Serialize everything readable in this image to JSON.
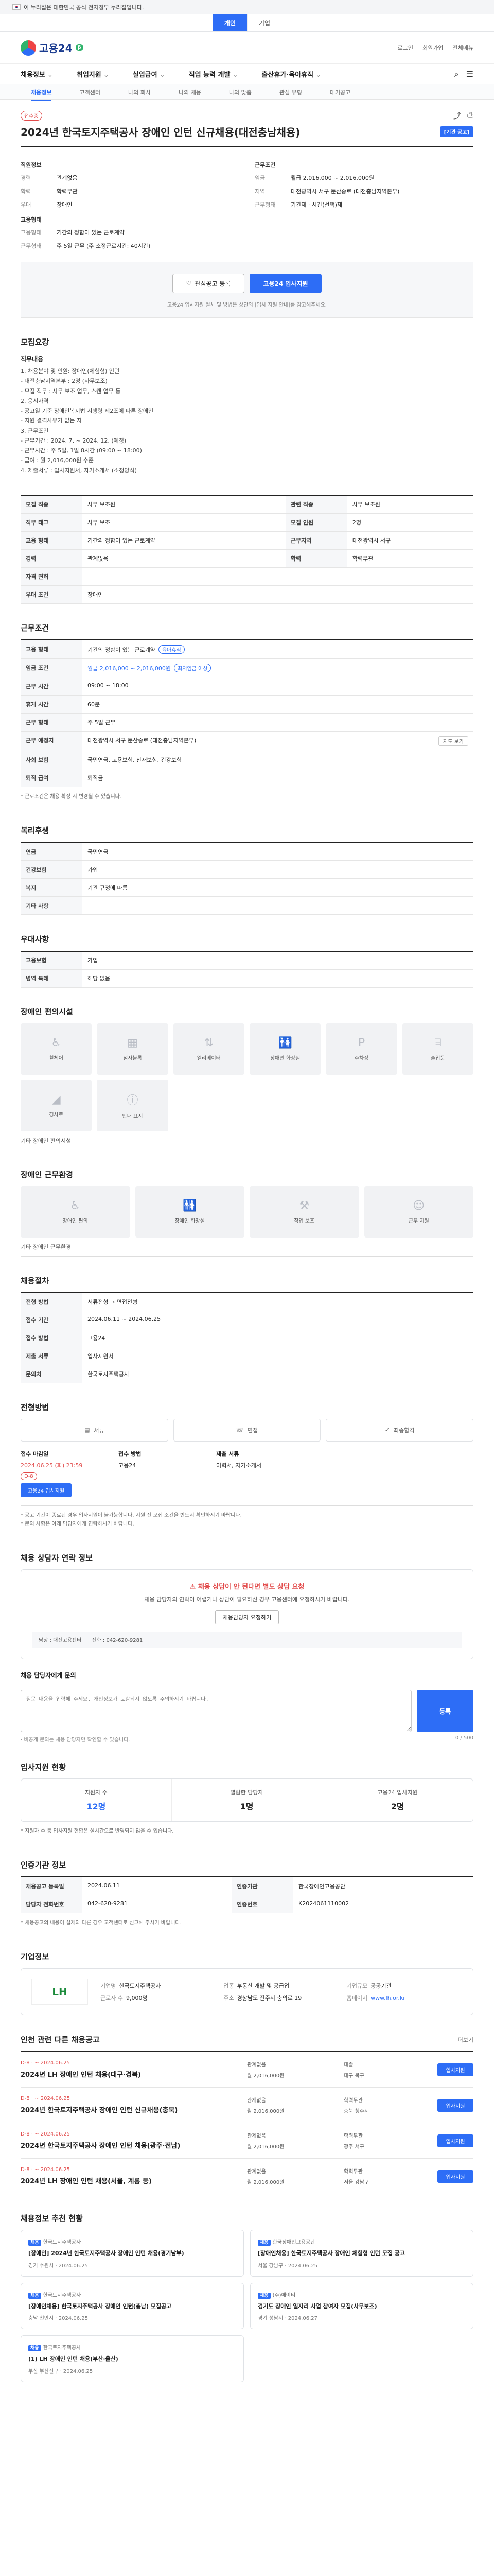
{
  "banner": {
    "text": "이 누리집은 대한민국 공식 전자정부 누리집입니다."
  },
  "top_tabs": [
    "개인",
    "기업"
  ],
  "logo": {
    "text": "고용24",
    "badge": "β"
  },
  "header_links": [
    "로그인",
    "회원가입",
    "전체메뉴"
  ],
  "gnb": [
    "채용정보",
    "취업지원",
    "실업급여",
    "직업 능력 개발",
    "출산휴가·육아휴직"
  ],
  "subnav": [
    "채용정보",
    "고객센터",
    "나의 회사",
    "나의 채용",
    "나의 맞춤",
    "관심 유형",
    "대기공고"
  ],
  "job": {
    "status_badge": "접수중",
    "title": "2024년 한국토지주택공사 장애인 인턴 신규채용(대전충남채용)",
    "apply_btn": "[기관 공고]",
    "summary_head_left": "직원정보",
    "summary_head_right": "근무조건",
    "summary_left": [
      {
        "k": "경력",
        "v": "관계없음"
      },
      {
        "k": "학력",
        "v": "학력무관"
      },
      {
        "k": "우대",
        "v": "장애인"
      }
    ],
    "summary_right": [
      {
        "k": "임금",
        "v": "월급 2,016,000 ~ 2,016,000원"
      },
      {
        "k": "지역",
        "v": "대전광역시 서구 둔산중로 (대전충남지역본부)"
      },
      {
        "k": "근무형태",
        "v": "기간제 · 시간(선택)제"
      }
    ],
    "summary_head2": "고용형태",
    "summary_rows2": [
      {
        "k": "고용형태",
        "v": "기간의 정함이 있는 근로계약"
      },
      {
        "k": "근무형태",
        "v": "주 5일 근무 (주 소정근로시간: 40시간)"
      }
    ]
  },
  "cta": {
    "interest": "관심공고 등록",
    "apply": "고용24 입사지원",
    "note": "고용24 입사지원 절차 및 방법은 상단의 [입사 지원 안내]를 참고해주세요."
  },
  "recruit": {
    "title": "모집요강",
    "sub": "직무내용",
    "text": "1. 채용분야 및 인원: 장애인(체험형) 인턴\n- 대전충남지역본부 : 2명 (사무보조)\n- 모집 직무 : 사무 보조 업무, 스캔 업무 등\n2. 응시자격\n- 공고일 기준 장애인복지법 시행령 제2조에 따른 장애인\n- 지원 결격사유가 없는 자\n3. 근무조건\n- 근무기간 : 2024. 7. ~ 2024. 12. (예정)\n- 근무시간 : 주 5일, 1일 8시간 (09:00 ~ 18:00)\n- 급여 : 월 2,016,000원 수준\n4. 제출서류 : 입사지원서, 자기소개서 (소정양식)"
  },
  "recruit_table": [
    {
      "k": "모집 직종",
      "v": "사무 보조원",
      "k2": "관련 직종",
      "v2": "사무 보조원"
    },
    {
      "k": "직무 태그",
      "v": "사무 보조",
      "k2": "모집 인원",
      "v2": "2명"
    },
    {
      "k": "고용 형태",
      "v": "기간의 정함이 있는 근로계약",
      "k2": "근무지역",
      "v2": "대전광역시 서구"
    },
    {
      "k": "경력",
      "v": "관계없음",
      "k2": "학력",
      "v2": "학력무관"
    },
    {
      "k": "자격 면허",
      "v": "",
      "k2": "",
      "v2": ""
    },
    {
      "k": "우대 조건",
      "v": "장애인",
      "k2": "",
      "v2": ""
    }
  ],
  "work_cond": {
    "title": "근무조건",
    "rows": [
      {
        "k": "고용 형태",
        "v": "기간의 정함이 있는 근로계약",
        "tag": "육아휴직"
      },
      {
        "k": "임금 조건",
        "v": "월급 2,016,000 ~ 2,016,000원",
        "tag": "최저임금 이상"
      },
      {
        "k": "근무 시간",
        "v": "09:00 ~ 18:00"
      },
      {
        "k": "휴게 시간",
        "v": "60분"
      },
      {
        "k": "근무 형태",
        "v": "주 5일 근무"
      },
      {
        "k": "근무 예정지",
        "v": "대전광역시 서구 둔산중로 (대전충남지역본부)"
      },
      {
        "k": "사회 보험",
        "v": "국민연금, 고용보험, 산재보험, 건강보험"
      },
      {
        "k": "퇴직 급여",
        "v": "퇴직금"
      }
    ],
    "note": "* 근로조건은 채용 확정 시 변경될 수 있습니다."
  },
  "benefit": {
    "title": "복리후생",
    "rows": [
      {
        "k": "연금",
        "v": "국민연금"
      },
      {
        "k": "건강보험",
        "v": "가입"
      },
      {
        "k": "복지",
        "v": "기관 규정에 따름"
      },
      {
        "k": "기타 사항",
        "v": ""
      }
    ]
  },
  "manner": {
    "title": "우대사항",
    "rows": [
      {
        "k": "고용보험",
        "v": "가입"
      },
      {
        "k": "병역 특례",
        "v": "해당 없음"
      }
    ]
  },
  "facility": {
    "title": "장애인 편의시설",
    "icons": [
      "휠체어",
      "점자블록",
      "엘리베이터",
      "장애인 화장실",
      "주차장",
      "출입문",
      "경사로",
      "안내 표지"
    ],
    "note": "기타 장애인 편의시설"
  },
  "env": {
    "title": "장애인 근무환경",
    "icons": [
      "장애인 편의",
      "장애인 화장실",
      "작업 보조",
      "근무 지원"
    ],
    "note": "기타 장애인 근무환경"
  },
  "selection": {
    "title": "채용절차",
    "rows": [
      {
        "k": "전형 방법",
        "v": "서류전형 → 면접전형"
      },
      {
        "k": "접수 기간",
        "v": "2024.06.11 ~ 2024.06.25"
      },
      {
        "k": "접수 방법",
        "v": "고용24"
      },
      {
        "k": "제출 서류",
        "v": "입사지원서"
      },
      {
        "k": "문의처",
        "v": "한국토지주택공사"
      }
    ]
  },
  "process": {
    "title": "전형방법",
    "steps": [
      "서류",
      "면접",
      "최종합격"
    ]
  },
  "apply": {
    "label1": "접수 마감일",
    "deadline": "2024.06.25 (화) 23:59",
    "remain": "D-8",
    "label2": "접수 방법",
    "method": "고용24",
    "label3": "제출 서류",
    "docs": "이력서, 자기소개서",
    "btn": "고용24 입사지원",
    "notice": "* 공고 기간이 종료된 경우 입사지원이 불가능합니다. 지원 전 모집 조건을 반드시 확인하시기 바랍니다.\n* 문의 사항은 아래 담당자에게 연락하시기 바랍니다."
  },
  "sos": {
    "head": "채용 상담자 연락 정보",
    "sub": "채용 상담이 안 된다면 별도 상담 요청",
    "body": "채용 담당자의 연락이 어렵거나 상담이 필요하신 경우 고용센터에 요청하시기 바랍니다.",
    "btn": "채용담당자 요청하기",
    "bar": [
      "담당 : 대전고용센터",
      "전화 : 042-620-9281"
    ]
  },
  "qa": {
    "title": "채용 담당자에게 문의",
    "placeholder": "질문 내용을 입력해 주세요. 개인정보가 포함되지 않도록 주의하시기 바랍니다.",
    "btn": "등록",
    "count": "0 / 500",
    "foot": "· 비공개 문의는 채용 담당자만 확인할 수 있습니다."
  },
  "stats": {
    "title": "입사지원 현황",
    "items": [
      {
        "label": "지원자 수",
        "value": "12명"
      },
      {
        "label": "열람한 담당자",
        "value": "1명"
      },
      {
        "label": "고용24 입사지원",
        "value": "2명"
      }
    ],
    "note": "* 지원자 수 등 입사지원 현황은 실시간으로 반영되지 않을 수 있습니다."
  },
  "manager": {
    "title": "인증기관 정보",
    "rows": [
      {
        "k": "채용공고 등록일",
        "v": "2024.06.11",
        "k2": "인증기관",
        "v2": "한국장애인고용공단"
      },
      {
        "k": "담당자 전화번호",
        "v": "042-620-9281",
        "k2": "인증번호",
        "v2": "K2024061110002"
      }
    ],
    "note": "* 채용공고의 내용이 실제와 다른 경우 고객센터로 신고해 주시기 바랍니다."
  },
  "company": {
    "title": "기업정보",
    "logo": "LH",
    "name_k": "기업명",
    "name": "한국토지주택공사",
    "type_k": "업종",
    "type": "부동산 개발 및 공급업",
    "size_k": "기업규모",
    "size": "공공기관",
    "emp_k": "근로자 수",
    "emp": "9,000명",
    "addr_k": "주소",
    "addr": "경상남도 진주시 충의로 19",
    "home_k": "홈페이지",
    "home": "www.lh.or.kr"
  },
  "other_jobs": {
    "title": "인천 관련 다른 채용공고",
    "more": "더보기",
    "items": [
      {
        "dday": "D-8 · ~ 2024.06.25",
        "title": "2024년 LH 장애인 인턴 채용(대구·경북)",
        "m1": "관계없음",
        "m2": "대졸",
        "m3": "월 2,016,000원",
        "m4": "대구 북구",
        "btn": "입사지원"
      },
      {
        "dday": "D-8 · ~ 2024.06.25",
        "title": "2024년 한국토지주택공사 장애인 인턴 신규채용(충북)",
        "m1": "관계없음",
        "m2": "학력무관",
        "m3": "월 2,016,000원",
        "m4": "충북 청주시",
        "btn": "입사지원"
      },
      {
        "dday": "D-8 · ~ 2024.06.25",
        "title": "2024년 한국토지주택공사 장애인 인턴 채용(광주·전남)",
        "m1": "관계없음",
        "m2": "학력무관",
        "m3": "월 2,016,000원",
        "m4": "광주 서구",
        "btn": "입사지원"
      },
      {
        "dday": "D-8 · ~ 2024.06.25",
        "title": "2024년 LH 장애인 인턴 채용(서울, 계룡 등)",
        "m1": "관계없음",
        "m2": "학력무관",
        "m3": "월 2,016,000원",
        "m4": "서울 강남구",
        "btn": "입사지원"
      }
    ]
  },
  "related": {
    "title": "채용정보 추천 현황",
    "items": [
      {
        "co": "한국토지주택공사",
        "title": "[장애인] 2024년 한국토지주택공사 장애인 인턴 채용(경기남부)",
        "meta": "경기 수원시 · 2024.06.25"
      },
      {
        "co": "한국장애인고용공단",
        "title": "[장애인채용] 한국토지주택공사 장애인 체험형 인턴 모집 공고",
        "meta": "서울 강남구 · 2024.06.25"
      },
      {
        "co": "한국토지주택공사",
        "title": "[장애인채용] 한국토지주택공사 장애인 인턴(충남) 모집공고",
        "meta": "충남 천안시 · 2024.06.25"
      },
      {
        "co": "(주)에이티",
        "title": "경기도 장애인 일자리 사업 참여자 모집(사무보조)",
        "meta": "경기 성남시 · 2024.06.27"
      },
      {
        "co": "한국토지주택공사",
        "title": "(1) LH 장애인 인턴 채용(부산·울산)",
        "meta": "부산 부산진구 · 2024.06.25"
      }
    ]
  }
}
